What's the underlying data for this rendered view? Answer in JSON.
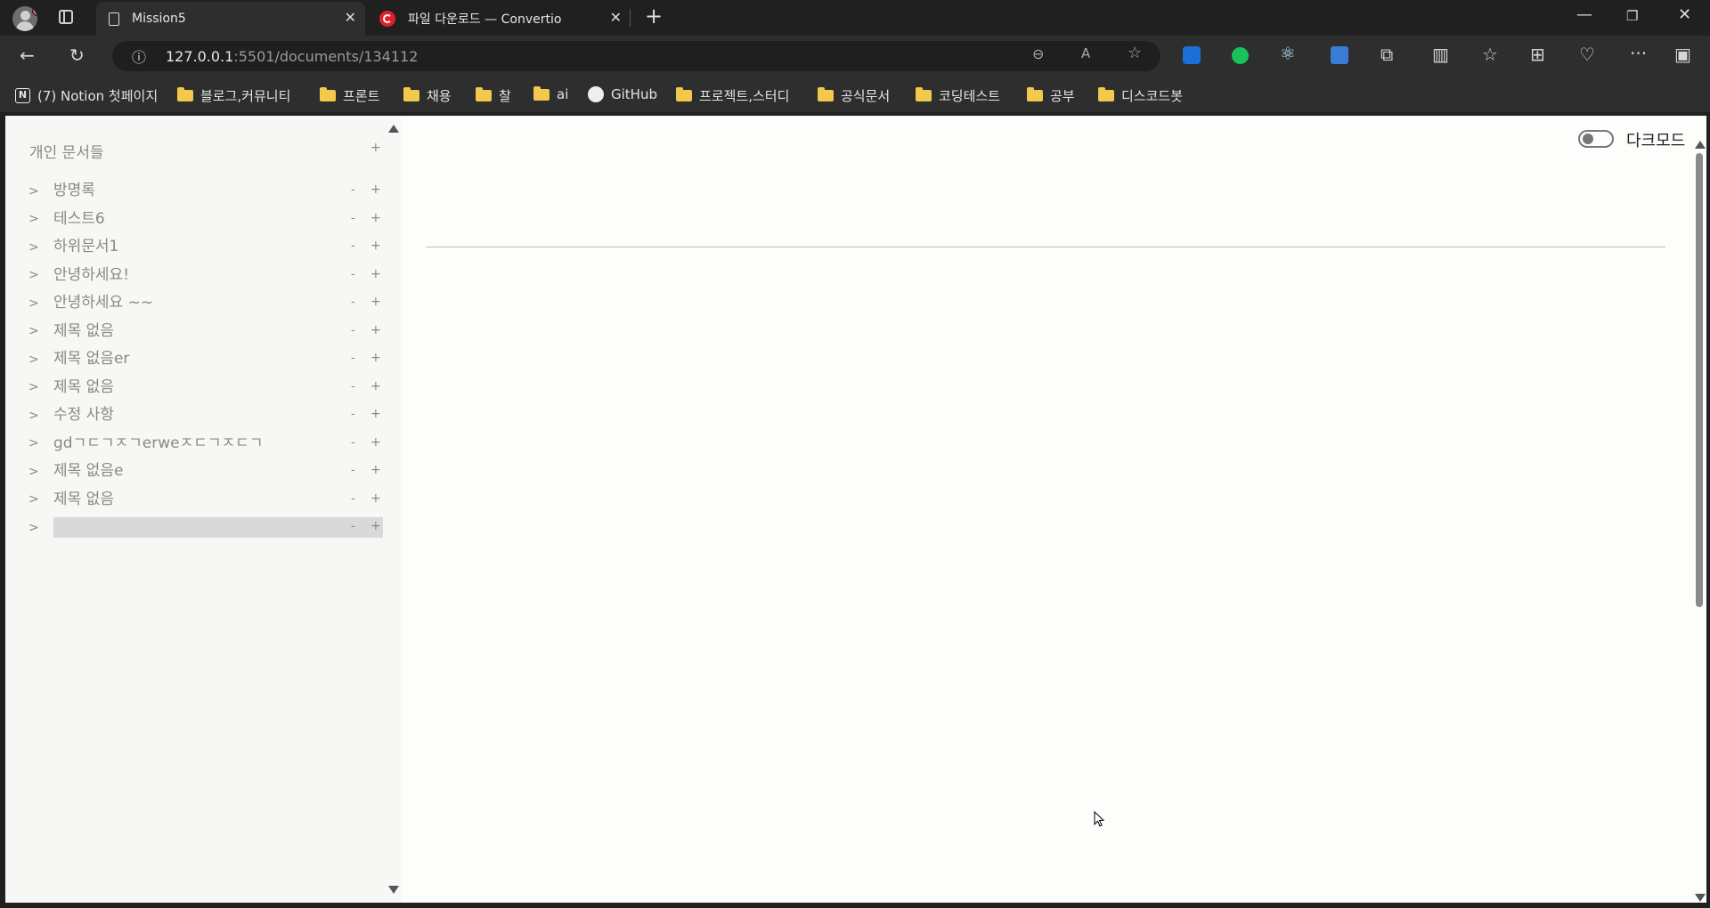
{
  "browser": {
    "tabs": [
      {
        "title": "Mission5",
        "active": true
      },
      {
        "title": "파일 다운로드 — Convertio",
        "active": false
      }
    ],
    "url_host": "127.0.0.1",
    "url_rest": ":5501/documents/134112",
    "bookmarks": [
      "(7) Notion 첫페이지",
      "블로그,커뮤니티",
      "프론트",
      "채용",
      "찰",
      "ai",
      "GitHub",
      "프로젝트,스터디",
      "공식문서",
      "코딩테스트",
      "공부",
      "디스코드봇"
    ]
  },
  "sidebar": {
    "title": "개인 문서들",
    "add_label": "+",
    "items": [
      {
        "caret": ">",
        "title": "방명록",
        "minus": "-",
        "plus": "+"
      },
      {
        "caret": ">",
        "title": "테스트6",
        "minus": "-",
        "plus": "+"
      },
      {
        "caret": ">",
        "title": "하위문서1",
        "minus": "-",
        "plus": "+"
      },
      {
        "caret": ">",
        "title": "안녕하세요!",
        "minus": "-",
        "plus": "+"
      },
      {
        "caret": ">",
        "title": "안녕하세요 ~~",
        "minus": "-",
        "plus": "+"
      },
      {
        "caret": ">",
        "title": "제목 없음",
        "minus": "-",
        "plus": "+"
      },
      {
        "caret": ">",
        "title": "제목 없음er",
        "minus": "-",
        "plus": "+"
      },
      {
        "caret": ">",
        "title": "제목 없음",
        "minus": "-",
        "plus": "+"
      },
      {
        "caret": ">",
        "title": "수정 사항",
        "minus": "-",
        "plus": "+"
      },
      {
        "caret": ">",
        "title": "gdㄱㄷㄱㅈㄱerweㅈㄷㄱㅈㄷㄱ",
        "minus": "-",
        "plus": "+"
      },
      {
        "caret": ">",
        "title": "제목 없음e",
        "minus": "-",
        "plus": "+"
      },
      {
        "caret": ">",
        "title": "제목 없음",
        "minus": "-",
        "plus": "+"
      },
      {
        "caret": ">",
        "title": "",
        "minus": "-",
        "plus": "+"
      }
    ]
  },
  "main": {
    "darkmode_label": "다크모드",
    "darkmode_on": false
  }
}
